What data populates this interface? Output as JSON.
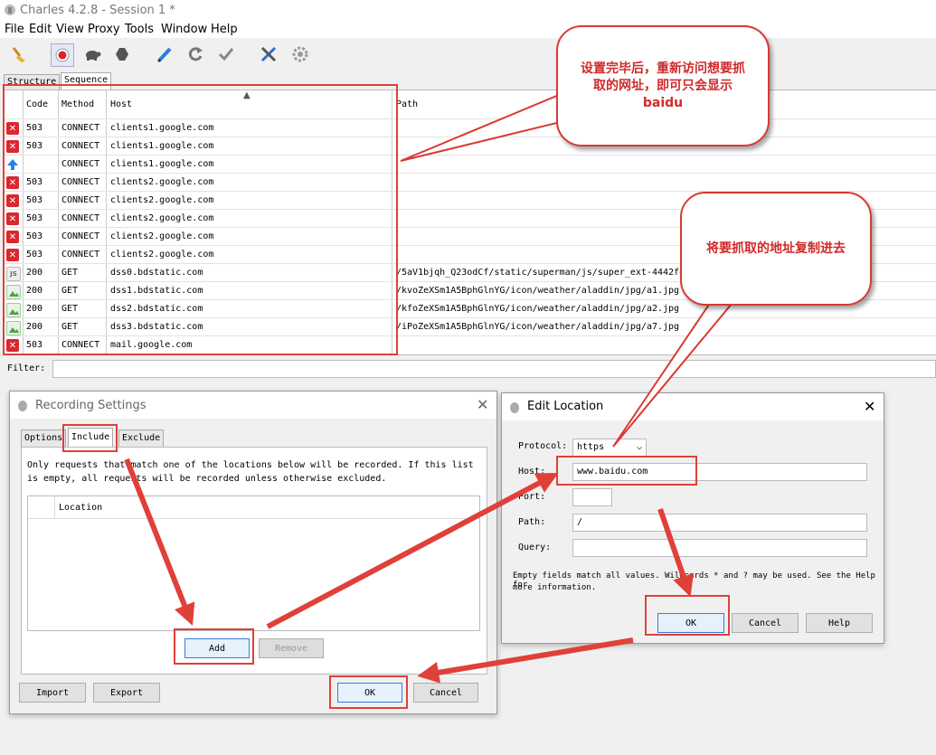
{
  "app": {
    "title": "Charles 4.2.8 - Session 1 *",
    "menu": [
      "File",
      "Edit",
      "View",
      "Proxy",
      "Tools",
      "Window",
      "Help"
    ]
  },
  "session": {
    "tabs": [
      "Structure",
      "Sequence"
    ],
    "columns": [
      "Code",
      "Method",
      "Host",
      "Path"
    ],
    "rows": [
      {
        "status": "error",
        "code": "503",
        "method": "CONNECT",
        "host": "clients1.google.com",
        "path": ""
      },
      {
        "status": "error",
        "code": "503",
        "method": "CONNECT",
        "host": "clients1.google.com",
        "path": ""
      },
      {
        "status": "upload",
        "code": "",
        "method": "CONNECT",
        "host": "clients1.google.com",
        "path": ""
      },
      {
        "status": "error",
        "code": "503",
        "method": "CONNECT",
        "host": "clients2.google.com",
        "path": ""
      },
      {
        "status": "error",
        "code": "503",
        "method": "CONNECT",
        "host": "clients2.google.com",
        "path": ""
      },
      {
        "status": "error",
        "code": "503",
        "method": "CONNECT",
        "host": "clients2.google.com",
        "path": ""
      },
      {
        "status": "error",
        "code": "503",
        "method": "CONNECT",
        "host": "clients2.google.com",
        "path": ""
      },
      {
        "status": "error",
        "code": "503",
        "method": "CONNECT",
        "host": "clients2.google.com",
        "path": ""
      },
      {
        "status": "js",
        "code": "200",
        "method": "GET",
        "host": "dss0.bdstatic.com",
        "path": "/5aV1bjqh_Q23odCf/static/superman/js/super_ext-4442fe"
      },
      {
        "status": "image",
        "code": "200",
        "method": "GET",
        "host": "dss1.bdstatic.com",
        "path": "/kvoZeXSm1A5BphGlnYG/icon/weather/aladdin/jpg/a1.jpg"
      },
      {
        "status": "image",
        "code": "200",
        "method": "GET",
        "host": "dss2.bdstatic.com",
        "path": "/kfoZeXSm1A5BphGlnYG/icon/weather/aladdin/jpg/a2.jpg"
      },
      {
        "status": "image",
        "code": "200",
        "method": "GET",
        "host": "dss3.bdstatic.com",
        "path": "/iPoZeXSm1A5BphGlnYG/icon/weather/aladdin/jpg/a7.jpg"
      },
      {
        "status": "error",
        "code": "503",
        "method": "CONNECT",
        "host": "mail.google.com",
        "path": ""
      }
    ],
    "filter_label": "Filter:"
  },
  "recording_settings": {
    "title": "Recording Settings",
    "tabs": [
      "Options",
      "Include",
      "Exclude"
    ],
    "description_line1": "Only requests that match one of the locations below will be recorded.  If this list",
    "description_line2": "is empty, all requests will be recorded unless otherwise excluded.",
    "column_location": "Location",
    "add": "Add",
    "remove": "Remove",
    "import": "Import",
    "export": "Export",
    "ok": "OK",
    "cancel": "Cancel"
  },
  "edit_location": {
    "title": "Edit Location",
    "protocol_label": "Protocol:",
    "protocol_value": "https",
    "host_label": "Host:",
    "host_value": "www.baidu.com",
    "port_label": "Port:",
    "port_value": "",
    "path_label": "Path:",
    "path_value": "/",
    "query_label": "Query:",
    "query_value": "",
    "hint_line1": "Empty fields match all values. Wildcards * and ? may be used. See the Help for",
    "hint_line2": "more information.",
    "ok": "OK",
    "cancel": "Cancel",
    "help": "Help"
  },
  "annotations": {
    "bubble1_line1": "设置完毕后，重新访问想要抓",
    "bubble1_line2": "取的网址，即可只会显示",
    "bubble1_line3": "baidu",
    "bubble2": "将要抓取的地址复制进去"
  },
  "colors": {
    "accent_red": "#e0403a",
    "error_icon": "#d9282f",
    "upload_icon": "#2a7fe0",
    "image_icon": "#4aa04a"
  }
}
